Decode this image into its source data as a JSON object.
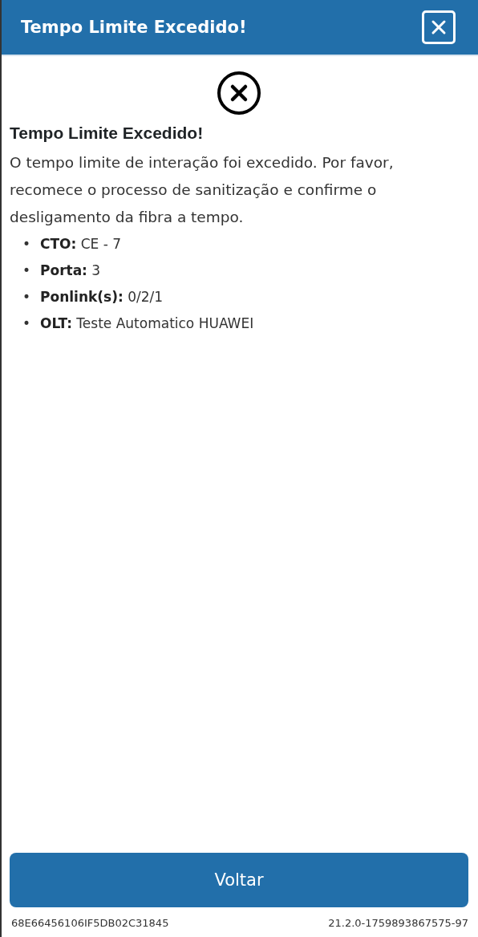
{
  "header": {
    "title": "Tempo Limite Excedido!"
  },
  "heading": "Tempo Limite Excedido!",
  "message": "O tempo limite de interação foi excedido. Por favor, recomece o processo de sanitização e confirme o desligamento da fibra a tempo.",
  "details": [
    {
      "marker": "•",
      "label": "CTO:",
      "value": "CE - 7"
    },
    {
      "marker": "•",
      "label": "Porta:",
      "value": "3"
    },
    {
      "marker": "•",
      "label": "Ponlink(s):",
      "value": "0/2/1"
    },
    {
      "marker": "•",
      "label": "OLT:",
      "value": "Teste Automatico HUAWEI"
    }
  ],
  "button": "Voltar",
  "footer": {
    "id": "68E66456106IF5DB02C31845",
    "version": "21.2.0-1759893867575-97"
  }
}
